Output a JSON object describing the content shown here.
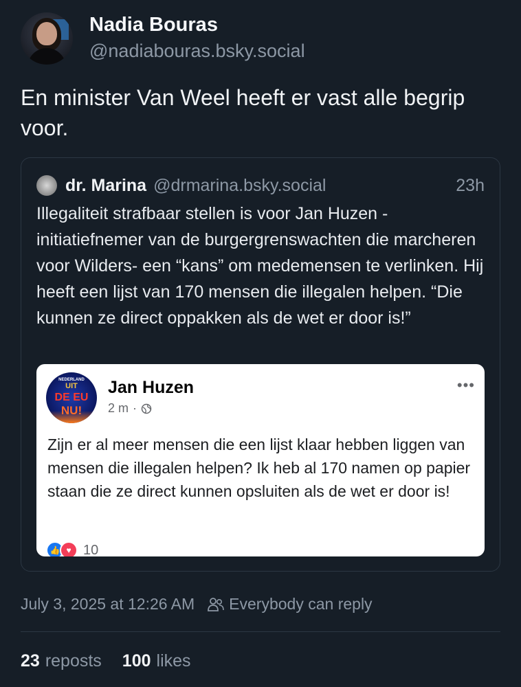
{
  "post": {
    "author": {
      "display_name": "Nadia Bouras",
      "handle": "@nadiabouras.bsky.social"
    },
    "text": "En minister Van Weel heeft er vast alle begrip voor.",
    "timestamp": "July 3, 2025 at 12:26 AM",
    "reply_setting": "Everybody can reply",
    "reposts_count": "23",
    "reposts_label": "reposts",
    "likes_count": "100",
    "likes_label": "likes"
  },
  "quote": {
    "display_name": "dr. Marina",
    "handle": "@drmarina.bsky.social",
    "time_ago": "23h",
    "text": "Illegaliteit strafbaar stellen is voor Jan Huzen -initiatiefnemer van de burgergrenswachten die marcheren voor Wilders- een “kans” om medemensen te verlinken. Hij heeft een lijst van 170 mensen die illegalen helpen. “Die kunnen ze direct oppakken als de wet er door is!”"
  },
  "embed": {
    "avatar_text": [
      "NEDERLAND",
      "UIT",
      "DE EU",
      "NU!"
    ],
    "name": "Jan Huzen",
    "meta_time": "2 m",
    "meta_sep": "·",
    "more": "•••",
    "text": "Zijn er al meer mensen die een lijst klaar hebben liggen van mensen die illegalen helpen? Ik heb al 170 namen op papier staan die ze direct kunnen opsluiten als de wet er door is!",
    "reaction_count": "10"
  },
  "colors": {
    "background": "#161e27",
    "muted_text": "#8d98a5",
    "border": "#2c3743",
    "fb_like": "#1877f2",
    "fb_love": "#f33e58"
  }
}
